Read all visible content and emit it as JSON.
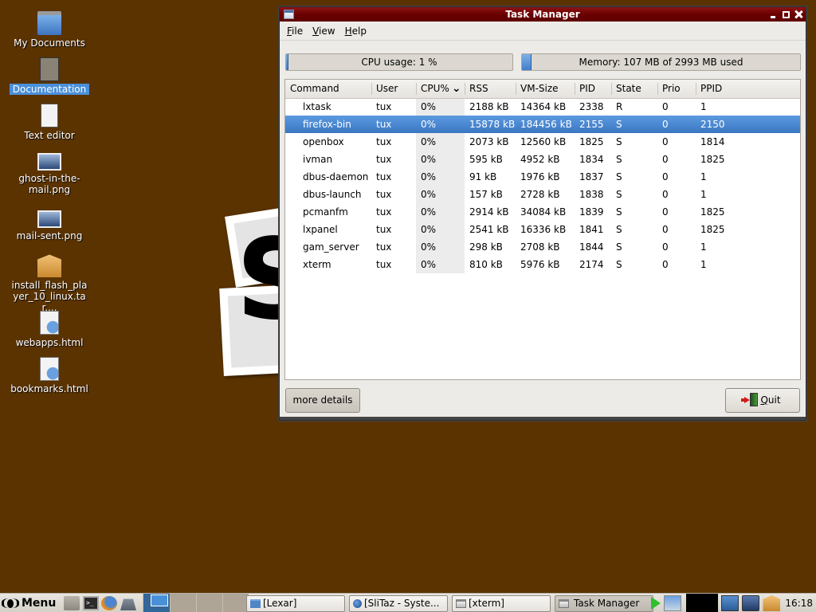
{
  "desktop": {
    "icons": [
      {
        "label": "My Documents",
        "icon": "home-folder-icon"
      },
      {
        "label": "Documentation",
        "icon": "spider-doc-icon",
        "selected": true
      },
      {
        "label": "Text editor",
        "icon": "text-editor-icon"
      },
      {
        "label": "ghost-in-the-mail.png",
        "icon": "image-file-icon"
      },
      {
        "label": "mail-sent.png",
        "icon": "image-file-icon"
      },
      {
        "label": "install_flash_player_10_linux.tar....",
        "icon": "package-icon"
      },
      {
        "label": "webapps.html",
        "icon": "html-file-icon"
      },
      {
        "label": "bookmarks.html",
        "icon": "html-file-icon"
      }
    ],
    "wallpaper_letter": "S"
  },
  "window": {
    "title": "Task Manager",
    "menu": {
      "file": {
        "label": "File",
        "accel": "F",
        "rest": "ile"
      },
      "view": {
        "label": "View",
        "accel": "V",
        "rest": "iew"
      },
      "help": {
        "label": "Help",
        "accel": "H",
        "rest": "elp"
      }
    },
    "cpu": {
      "label": "CPU usage: 1 %",
      "percent": 1
    },
    "memory": {
      "label": "Memory: 107 MB of 2993 MB used",
      "used_mb": 107,
      "total_mb": 2993
    },
    "table": {
      "columns": [
        "Command",
        "User",
        "CPU%",
        "RSS",
        "VM-Size",
        "PID",
        "State",
        "Prio",
        "PPID"
      ],
      "sort_column": "CPU%",
      "rows": [
        {
          "command": "lxtask",
          "user": "tux",
          "cpu": "0%",
          "rss": "2188 kB",
          "vmsize": "14364 kB",
          "pid": "2338",
          "state": "R",
          "prio": "0",
          "ppid": "1"
        },
        {
          "command": "firefox-bin",
          "user": "tux",
          "cpu": "0%",
          "rss": "15878 kB",
          "vmsize": "184456 kB",
          "pid": "2155",
          "state": "S",
          "prio": "0",
          "ppid": "2150",
          "selected": true
        },
        {
          "command": "openbox",
          "user": "tux",
          "cpu": "0%",
          "rss": "2073 kB",
          "vmsize": "12560 kB",
          "pid": "1825",
          "state": "S",
          "prio": "0",
          "ppid": "1814"
        },
        {
          "command": "ivman",
          "user": "tux",
          "cpu": "0%",
          "rss": "595 kB",
          "vmsize": "4952 kB",
          "pid": "1834",
          "state": "S",
          "prio": "0",
          "ppid": "1825"
        },
        {
          "command": "dbus-daemon",
          "user": "tux",
          "cpu": "0%",
          "rss": "91 kB",
          "vmsize": "1976 kB",
          "pid": "1837",
          "state": "S",
          "prio": "0",
          "ppid": "1"
        },
        {
          "command": "dbus-launch",
          "user": "tux",
          "cpu": "0%",
          "rss": "157 kB",
          "vmsize": "2728 kB",
          "pid": "1838",
          "state": "S",
          "prio": "0",
          "ppid": "1"
        },
        {
          "command": "pcmanfm",
          "user": "tux",
          "cpu": "0%",
          "rss": "2914 kB",
          "vmsize": "34084 kB",
          "pid": "1839",
          "state": "S",
          "prio": "0",
          "ppid": "1825"
        },
        {
          "command": "lxpanel",
          "user": "tux",
          "cpu": "0%",
          "rss": "2541 kB",
          "vmsize": "16336 kB",
          "pid": "1841",
          "state": "S",
          "prio": "0",
          "ppid": "1825"
        },
        {
          "command": "gam_server",
          "user": "tux",
          "cpu": "0%",
          "rss": "298 kB",
          "vmsize": "2708 kB",
          "pid": "1844",
          "state": "S",
          "prio": "0",
          "ppid": "1"
        },
        {
          "command": "xterm",
          "user": "tux",
          "cpu": "0%",
          "rss": "810 kB",
          "vmsize": "5976 kB",
          "pid": "2174",
          "state": "S",
          "prio": "0",
          "ppid": "1"
        }
      ]
    },
    "buttons": {
      "more_details": "more details",
      "quit": {
        "label": "Quit",
        "accel": "Q",
        "rest": "uit"
      }
    }
  },
  "taskbar": {
    "menu_label": "Menu",
    "launchers": [
      "file-manager-icon",
      "terminal-icon",
      "firefox-icon",
      "drive-icon"
    ],
    "desktops": 4,
    "active_desktop": 1,
    "tasks": [
      {
        "label": "[Lexar]",
        "icon": "folder-icon"
      },
      {
        "label": "[SliTaz - Syste...",
        "icon": "globe-icon"
      },
      {
        "label": "[xterm]",
        "icon": "window-icon"
      },
      {
        "label": "Task Manager",
        "icon": "window-icon",
        "active": true
      }
    ],
    "clock": "16:18"
  },
  "colors": {
    "desktop_bg": "#5a3300",
    "titlebar": "#6a0000",
    "selection": "#4a87d0"
  }
}
